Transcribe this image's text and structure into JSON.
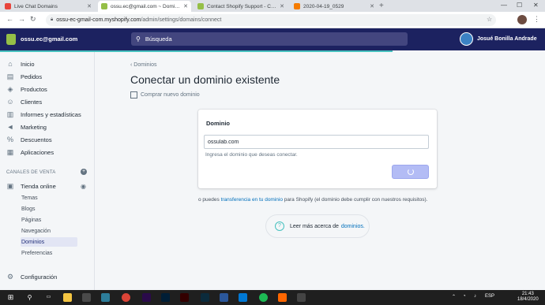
{
  "browser": {
    "tabs": [
      {
        "label": "Live Chat Domains",
        "color": "#e8453c"
      },
      {
        "label": "ossu.ec@gmail.com ~ Dominios",
        "color": "#95bf47"
      },
      {
        "label": "Contact Shopify Support - Centr...",
        "color": "#95bf47"
      },
      {
        "label": "2020-04-19_0529",
        "color": "#f57c00"
      }
    ],
    "url_host": "ossu-ec-gmail-com.myshopify.com",
    "url_path": "/admin/settings/domains/connect"
  },
  "topbar": {
    "shop_name": "ossu.ec@gmail.com",
    "search_placeholder": "Búsqueda",
    "user_name": "Josué Bonilla Andrade"
  },
  "sidebar": {
    "items": [
      {
        "label": "Inicio",
        "icon": "home-icon",
        "glyph": "⌂"
      },
      {
        "label": "Pedidos",
        "icon": "orders-icon",
        "glyph": "▤"
      },
      {
        "label": "Productos",
        "icon": "tag-icon",
        "glyph": "◈"
      },
      {
        "label": "Clientes",
        "icon": "customers-icon",
        "glyph": "☺"
      },
      {
        "label": "Informes y estadísticas",
        "icon": "analytics-icon",
        "glyph": "▥"
      },
      {
        "label": "Marketing",
        "icon": "marketing-icon",
        "glyph": "◄"
      },
      {
        "label": "Descuentos",
        "icon": "discount-icon",
        "glyph": "%"
      },
      {
        "label": "Aplicaciones",
        "icon": "apps-icon",
        "glyph": "▦"
      }
    ],
    "section_title": "CANALES DE VENTA",
    "channel": {
      "label": "Tienda online",
      "icon": "store-icon",
      "glyph": "▣"
    },
    "sub_items": [
      "Temas",
      "Blogs",
      "Páginas",
      "Navegación",
      "Dominios",
      "Preferencias"
    ],
    "settings_label": "Configuración"
  },
  "main": {
    "breadcrumb": "Dominios",
    "title": "Conectar un dominio existente",
    "buy_link": "Comprar nuevo dominio",
    "card": {
      "title": "Dominio",
      "input_value": "ossulab.com",
      "help": "Ingresa el dominio que deseas conectar."
    },
    "transfer_prefix": "o puedes ",
    "transfer_link": "transferencia en tu dominio",
    "transfer_suffix": " para Shopify (el dominio debe cumplir con nuestros requisitos).",
    "learn_prefix": "Leer más acerca de",
    "learn_link": "dominios."
  },
  "taskbar": {
    "lang": "ESP",
    "time": "21:43",
    "date": "18/4/2020"
  }
}
